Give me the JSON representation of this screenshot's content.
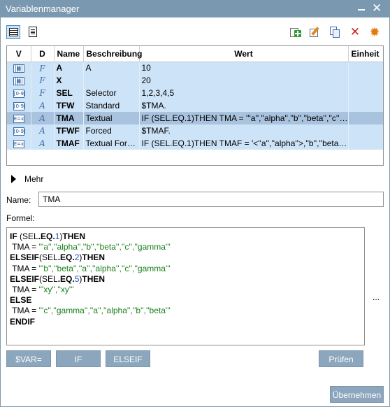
{
  "window": {
    "title": "Variablenmanager",
    "minimize": "—",
    "close": "✕"
  },
  "toolbar": {
    "view_list": "list-view-icon",
    "view_detail": "detail-view-icon",
    "actions": [
      "add-icon",
      "edit-icon",
      "copy-icon",
      "delete-icon",
      "settings-icon"
    ]
  },
  "table": {
    "columns": [
      "V",
      "D",
      "Name",
      "Beschreibung",
      "Wert",
      "Einheit"
    ],
    "rows": [
      {
        "v": "▦",
        "d": "F",
        "name": "A",
        "beschreibung": "A",
        "wert": "10",
        "einheit": "",
        "selected": false
      },
      {
        "v": "▦",
        "d": "F",
        "name": "X",
        "beschreibung": "",
        "wert": "20",
        "einheit": "",
        "selected": false
      },
      {
        "v": "[0-9]",
        "d": "F",
        "name": "SEL",
        "beschreibung": "Selector",
        "wert": "1,2,3,4,5",
        "einheit": "",
        "selected": false
      },
      {
        "v": "[0-9]",
        "d": "A",
        "name": "TFW",
        "beschreibung": "Standard",
        "wert": " $TMA.",
        "einheit": "",
        "selected": false
      },
      {
        "v": "E=x",
        "d": "A",
        "name": "TMA",
        "beschreibung": "Textual",
        "wert": "IF (SEL.EQ.1)THEN TMA = '''a'',''alpha'',''b'',''beta'',''c'',''…",
        "einheit": "",
        "selected": true
      },
      {
        "v": "[0-9]",
        "d": "A",
        "name": "TFWF",
        "beschreibung": "Forced",
        "wert": " $TMAF.",
        "einheit": "",
        "selected": false
      },
      {
        "v": "E=x",
        "d": "A",
        "name": "TMAF",
        "beschreibung": "Textual Forced",
        "wert": "IF (SEL.EQ.1)THEN TMAF = '<''a'',''alpha''>,''b'',''beta'',''…",
        "einheit": "",
        "selected": false
      }
    ]
  },
  "mehr": {
    "label": "Mehr"
  },
  "name_field": {
    "label": "Name:",
    "value": "TMA"
  },
  "formel": {
    "label": "Formel:",
    "lines": [
      [
        {
          "t": "IF",
          "c": "kw"
        },
        {
          "t": " (SEL",
          "c": ""
        },
        {
          "t": ".EQ.",
          "c": "kw"
        },
        {
          "t": "1",
          "c": "num"
        },
        {
          "t": ")",
          "c": ""
        },
        {
          "t": "THEN",
          "c": "kw"
        }
      ],
      [
        {
          "t": " TMA = ",
          "c": ""
        },
        {
          "t": "'''a'',''alpha'',''b'',''beta'',''c'',''gamma'''",
          "c": "str"
        }
      ],
      [
        {
          "t": "ELSEIF",
          "c": "kw"
        },
        {
          "t": "(SEL",
          "c": ""
        },
        {
          "t": ".EQ.",
          "c": "kw"
        },
        {
          "t": "2",
          "c": "num"
        },
        {
          "t": ")",
          "c": ""
        },
        {
          "t": "THEN",
          "c": "kw"
        }
      ],
      [
        {
          "t": " TMA = ",
          "c": ""
        },
        {
          "t": "'''b'',''beta'',''a'',''alpha'',''c'',''gamma'''",
          "c": "str"
        }
      ],
      [
        {
          "t": "ELSEIF",
          "c": "kw"
        },
        {
          "t": "(SEL",
          "c": ""
        },
        {
          "t": ".EQ.",
          "c": "kw"
        },
        {
          "t": "5",
          "c": "num"
        },
        {
          "t": ")",
          "c": ""
        },
        {
          "t": "THEN",
          "c": "kw"
        }
      ],
      [
        {
          "t": " TMA = ",
          "c": ""
        },
        {
          "t": "'''xy'',''xy'''",
          "c": "str"
        }
      ],
      [
        {
          "t": "ELSE",
          "c": "kw"
        }
      ],
      [
        {
          "t": " TMA = ",
          "c": ""
        },
        {
          "t": "'''c'',''gamma'',''a'',''alpha'',''b'',''beta'''",
          "c": "str"
        }
      ],
      [
        {
          "t": "ENDIF",
          "c": "kw"
        }
      ]
    ],
    "more": "..."
  },
  "buttons": {
    "svar": "$VAR=",
    "if": "IF",
    "elseif": "ELSEIF",
    "pruefen": "Prüfen",
    "uebernehmen": "Übernehmen"
  },
  "colors": {
    "titlebar": "#7a99b0",
    "row": "#cde3f8",
    "row_selected": "#a9c3df",
    "button": "#8ba6bd",
    "string": "#1a7f1a",
    "number": "#1a5bbf"
  }
}
